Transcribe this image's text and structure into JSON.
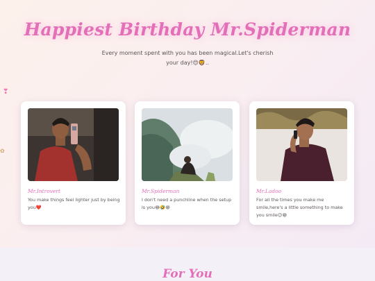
{
  "header": {
    "title": "Happiest Birthday Mr.Spiderman",
    "subtitle": "Every moment spent with you has been magical.Let's cherish your day!😍🦁.."
  },
  "decorations": {
    "left_top": "❣",
    "left_mid": "✿"
  },
  "cards": [
    {
      "name": "Mr.Introvert",
      "message": "You make things feel lighter just by being you❤️",
      "photo": "man in red shirt taking mirror selfie"
    },
    {
      "name": "Mr.Spiderman",
      "message": "I don't need a punchline when the setup is you😂🤣😁",
      "photo": "man sitting on misty hilltop"
    },
    {
      "name": "Mr.Ladoo",
      "message": "For all the times you make me smile,here's a little something to make you smile😉😁",
      "photo": "man in maroon shirt on phone call"
    }
  ],
  "section": {
    "title": "For You"
  },
  "colors": {
    "accent": "#e26fb8",
    "text": "#5e5658"
  }
}
